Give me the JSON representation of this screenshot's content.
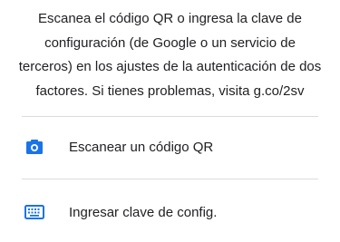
{
  "intro": {
    "lines": [
      "Escanea el código QR o ingresa la clave de",
      "configuración (de Google o un servicio de",
      "terceros) en los ajustes de la autenticación de dos",
      "factores. Si tienes problemas, visita g.co/2sv"
    ]
  },
  "options": [
    {
      "label": "Escanear un código QR",
      "icon": "camera-icon"
    },
    {
      "label": "Ingresar clave de config.",
      "icon": "keyboard-icon"
    }
  ],
  "colors": {
    "accent": "#1a73e8",
    "text": "#202124",
    "divider": "#dadce0"
  }
}
